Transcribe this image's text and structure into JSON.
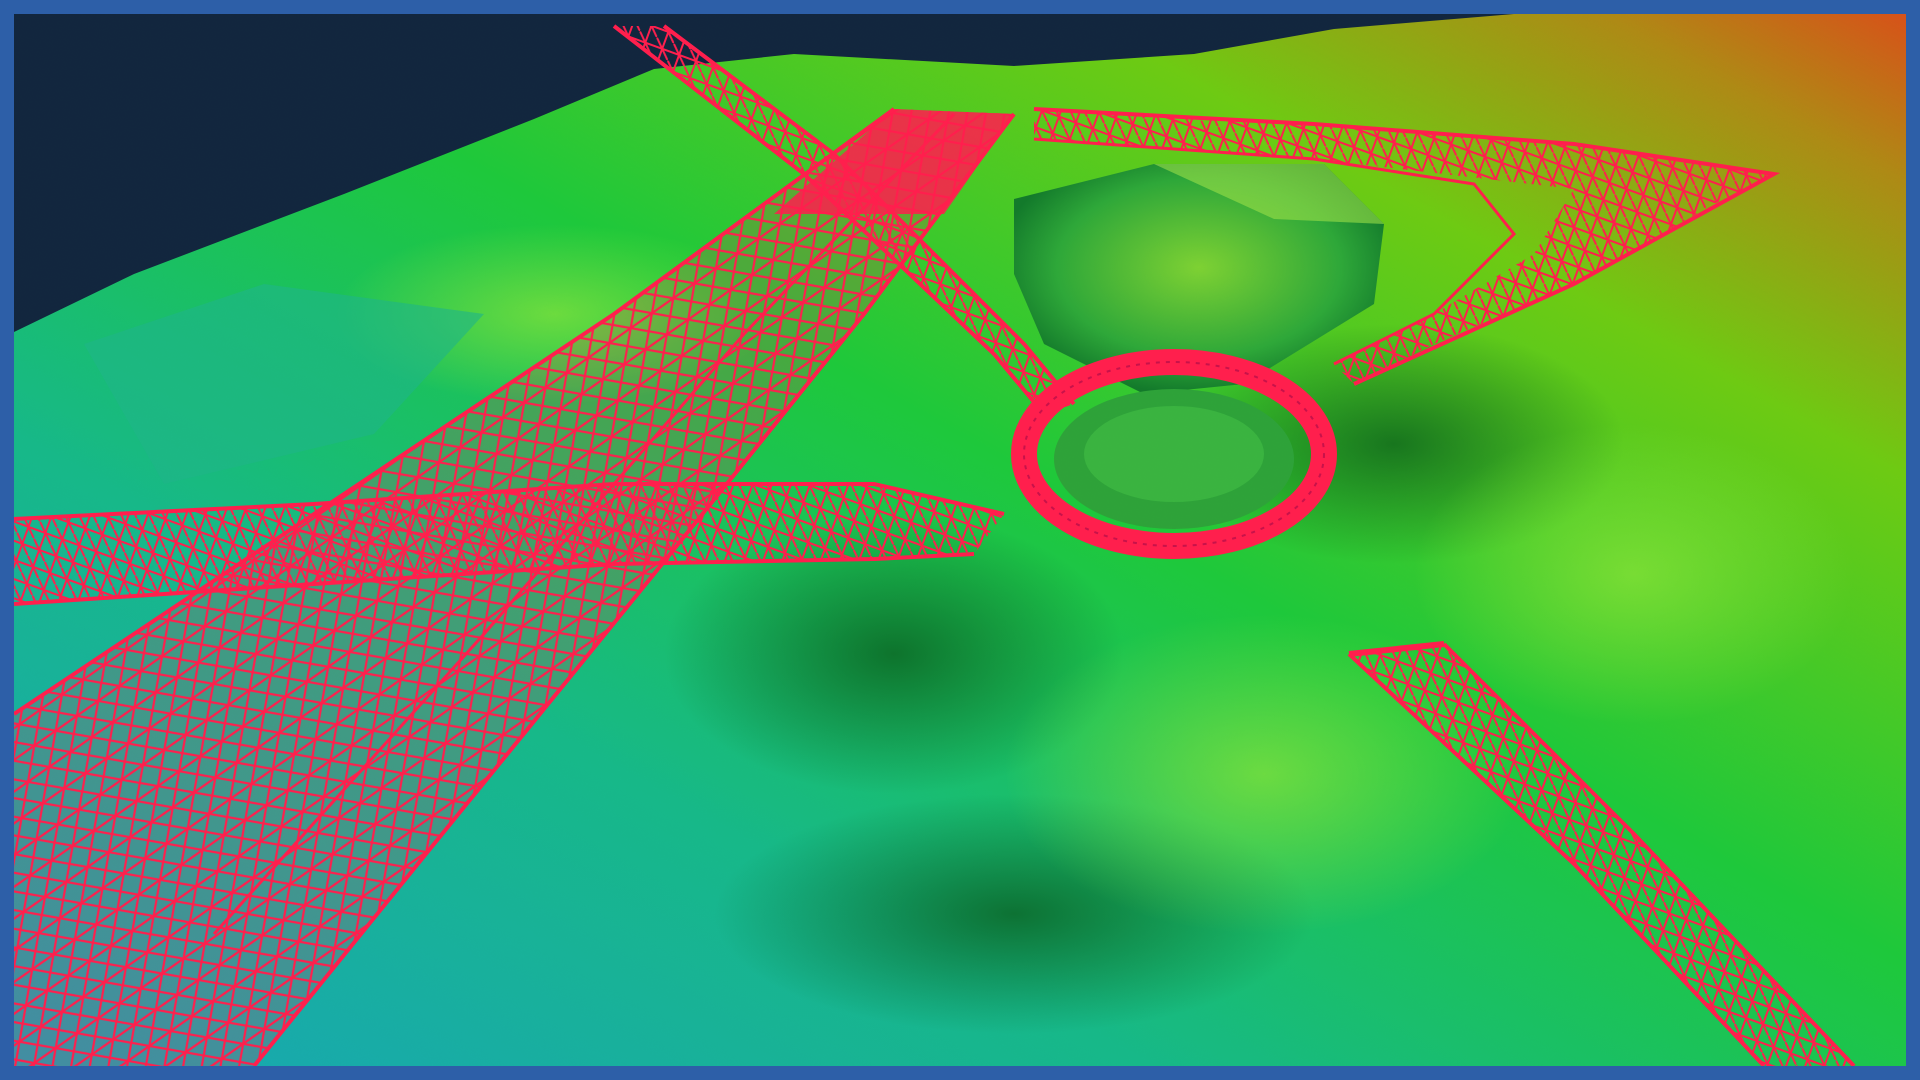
{
  "scene": {
    "description_visible_text": "",
    "colors": {
      "frame": "#2d5fa8",
      "sky": "#13263f",
      "terrain_low": "#1fb9b0",
      "terrain_mid": "#1fcc3c",
      "terrain_high": "#7ccf12",
      "terrain_peak": "#d9641a",
      "mesh": "#ff1f4d"
    },
    "elements": [
      "elevation-terrain",
      "mesh-main-carriageway",
      "mesh-roundabout",
      "mesh-north-arm",
      "mesh-northeast-arm",
      "mesh-west-arm",
      "mesh-southeast-arm"
    ]
  }
}
